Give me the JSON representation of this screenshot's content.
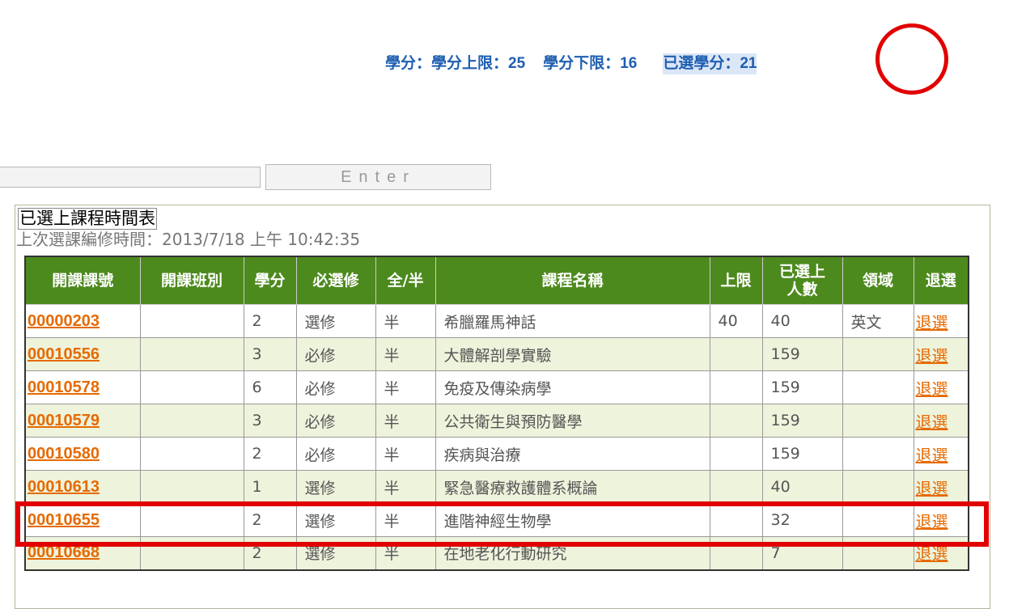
{
  "credits": {
    "label": "學分：",
    "upper_label": "學分上限：",
    "upper_value": "25",
    "lower_label": "學分下限：",
    "lower_value": "16",
    "selected_label": "已選學分",
    "selected_value": "：21"
  },
  "form": {
    "input_value": "",
    "enter_label": "Enter"
  },
  "schedule": {
    "title": "已選上課程時間表",
    "last_time": "上次選課編修時間：2013/7/18 上午 10:42:35",
    "headers": [
      "開課課號",
      "開課班別",
      "學分",
      "必選修",
      "全/半",
      "課程名稱",
      "上限",
      "已選上人數",
      "領域",
      "退選"
    ],
    "header_cur_line1": "已選上",
    "header_cur_line2": "人數",
    "rows": [
      {
        "code": "00000203",
        "class": "",
        "credits": "2",
        "type": "選修",
        "half": "半",
        "name": "希臘羅馬神話",
        "limit": "40",
        "current": "40",
        "domain": "英文",
        "drop": "退選"
      },
      {
        "code": "00010556",
        "class": "",
        "credits": "3",
        "type": "必修",
        "half": "半",
        "name": "大體解剖學實驗",
        "limit": "",
        "current": "159",
        "domain": "",
        "drop": "退選"
      },
      {
        "code": "00010578",
        "class": "",
        "credits": "6",
        "type": "必修",
        "half": "半",
        "name": "免疫及傳染病學",
        "limit": "",
        "current": "159",
        "domain": "",
        "drop": "退選"
      },
      {
        "code": "00010579",
        "class": "",
        "credits": "3",
        "type": "必修",
        "half": "半",
        "name": "公共衛生與預防醫學",
        "limit": "",
        "current": "159",
        "domain": "",
        "drop": "退選"
      },
      {
        "code": "00010580",
        "class": "",
        "credits": "2",
        "type": "必修",
        "half": "半",
        "name": "疾病與治療",
        "limit": "",
        "current": "159",
        "domain": "",
        "drop": "退選"
      },
      {
        "code": "00010613",
        "class": "",
        "credits": "1",
        "type": "選修",
        "half": "半",
        "name": "緊急醫療救護體系概論",
        "limit": "",
        "current": "40",
        "domain": "",
        "drop": "退選"
      },
      {
        "code": "00010655",
        "class": "",
        "credits": "2",
        "type": "選修",
        "half": "半",
        "name": "進階神經生物學",
        "limit": "",
        "current": "32",
        "domain": "",
        "drop": "退選"
      },
      {
        "code": "00010668",
        "class": "",
        "credits": "2",
        "type": "選修",
        "half": "半",
        "name": "在地老化行動研究",
        "limit": "",
        "current": "7",
        "domain": "",
        "drop": "退選"
      }
    ]
  },
  "colors": {
    "header_bg": "#4d8a1e",
    "link": "#e66a00",
    "annotation_red": "#e10000",
    "credits_text": "#1f5fb0"
  }
}
